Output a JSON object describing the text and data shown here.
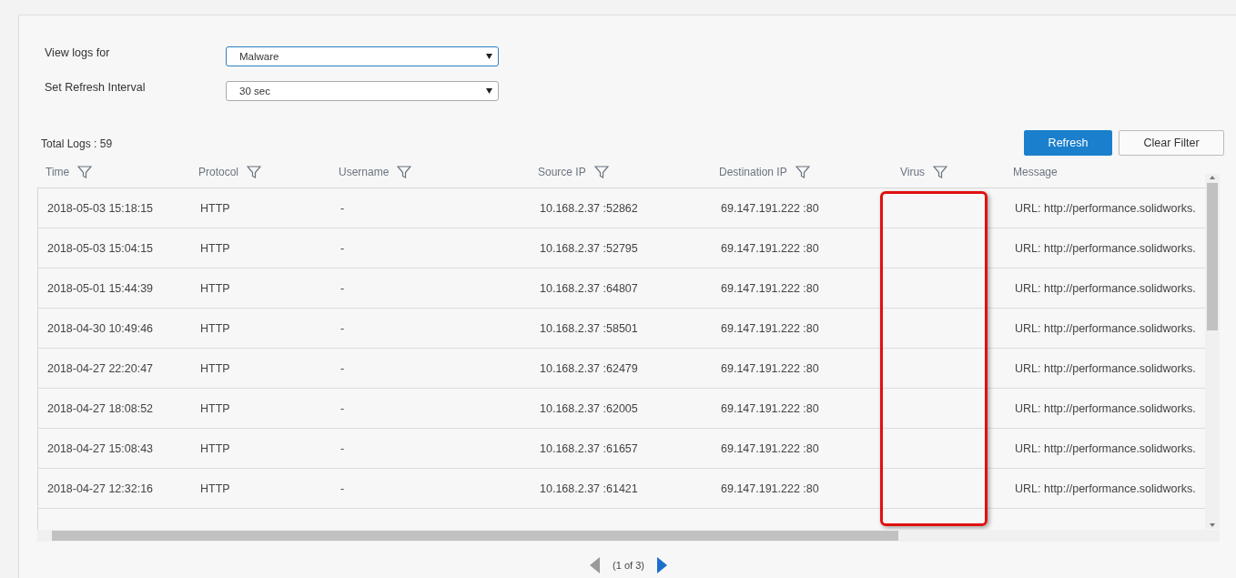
{
  "filters": [
    {
      "label": "View logs for",
      "value": "Malware",
      "focused": true
    },
    {
      "label": "Set Refresh Interval",
      "value": "30 sec",
      "focused": false
    }
  ],
  "total_logs": "Total Logs : 59",
  "buttons": [
    {
      "label": "Refresh",
      "kind": "primary"
    },
    {
      "label": "Clear Filter",
      "kind": "secondary"
    }
  ],
  "table": {
    "columns": [
      {
        "label": "Time",
        "filter": true,
        "highlighted": false
      },
      {
        "label": "Protocol",
        "filter": true,
        "highlighted": false
      },
      {
        "label": "Username",
        "filter": true,
        "highlighted": false
      },
      {
        "label": "Source IP",
        "filter": true,
        "highlighted": false
      },
      {
        "label": "Destination IP",
        "filter": true,
        "highlighted": false
      },
      {
        "label": "Virus",
        "filter": true,
        "highlighted": true
      },
      {
        "label": "Message",
        "filter": false,
        "highlighted": false
      }
    ],
    "rows": [
      [
        "2018-05-03 15:18:15",
        "HTTP",
        "-",
        "10.168.2.37 :52862",
        "69.147.191.222 :80",
        "",
        "URL: http://performance.solidworks."
      ],
      [
        "2018-05-03 15:04:15",
        "HTTP",
        "-",
        "10.168.2.37 :52795",
        "69.147.191.222 :80",
        "",
        "URL: http://performance.solidworks."
      ],
      [
        "2018-05-01 15:44:39",
        "HTTP",
        "-",
        "10.168.2.37 :64807",
        "69.147.191.222 :80",
        "",
        "URL: http://performance.solidworks."
      ],
      [
        "2018-04-30 10:49:46",
        "HTTP",
        "-",
        "10.168.2.37 :58501",
        "69.147.191.222 :80",
        "",
        "URL: http://performance.solidworks."
      ],
      [
        "2018-04-27 22:20:47",
        "HTTP",
        "-",
        "10.168.2.37 :62479",
        "69.147.191.222 :80",
        "",
        "URL: http://performance.solidworks."
      ],
      [
        "2018-04-27 18:08:52",
        "HTTP",
        "-",
        "10.168.2.37 :62005",
        "69.147.191.222 :80",
        "",
        "URL: http://performance.solidworks."
      ],
      [
        "2018-04-27 15:08:43",
        "HTTP",
        "-",
        "10.168.2.37 :61657",
        "69.147.191.222 :80",
        "",
        "URL: http://performance.solidworks."
      ],
      [
        "2018-04-27 12:32:16",
        "HTTP",
        "-",
        "10.168.2.37 :61421",
        "69.147.191.222 :80",
        "",
        "URL: http://performance.solidworks."
      ]
    ]
  },
  "pagination": {
    "label": "(1 of 3)",
    "prev_enabled": false,
    "next_enabled": true
  }
}
